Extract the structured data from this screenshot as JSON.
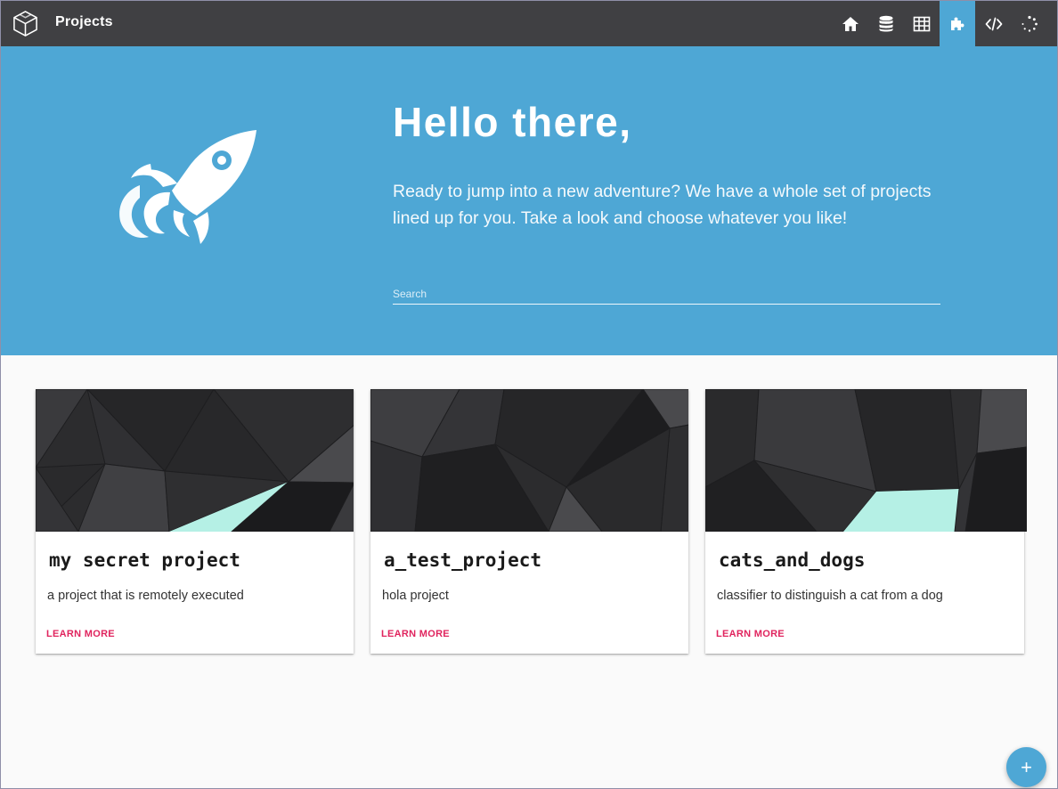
{
  "header": {
    "title": "Projects",
    "nav": [
      {
        "name": "home-icon",
        "active": false
      },
      {
        "name": "database-icon",
        "active": false
      },
      {
        "name": "table-icon",
        "active": false
      },
      {
        "name": "puzzle-icon",
        "active": true
      },
      {
        "name": "code-icon",
        "active": false
      },
      {
        "name": "spinner-icon",
        "active": false
      }
    ]
  },
  "hero": {
    "title": "Hello there,",
    "text": "Ready to jump into a new adventure? We have a whole set of projects lined up for you. Take a look and choose whatever you like!",
    "search_placeholder": "Search"
  },
  "projects": [
    {
      "title": "my secret project",
      "description": "a project that is remotely executed",
      "link": "LEARN MORE"
    },
    {
      "title": "a_test_project",
      "description": "hola project",
      "link": "LEARN MORE"
    },
    {
      "title": "cats_and_dogs",
      "description": "classifier to distinguish a cat from a dog",
      "link": "LEARN MORE"
    }
  ],
  "fab": {
    "label": "+"
  },
  "colors": {
    "topbar": "#404043",
    "accent": "#4ea7d5",
    "link": "#e0245e",
    "highlight": "#b5f0e5"
  }
}
